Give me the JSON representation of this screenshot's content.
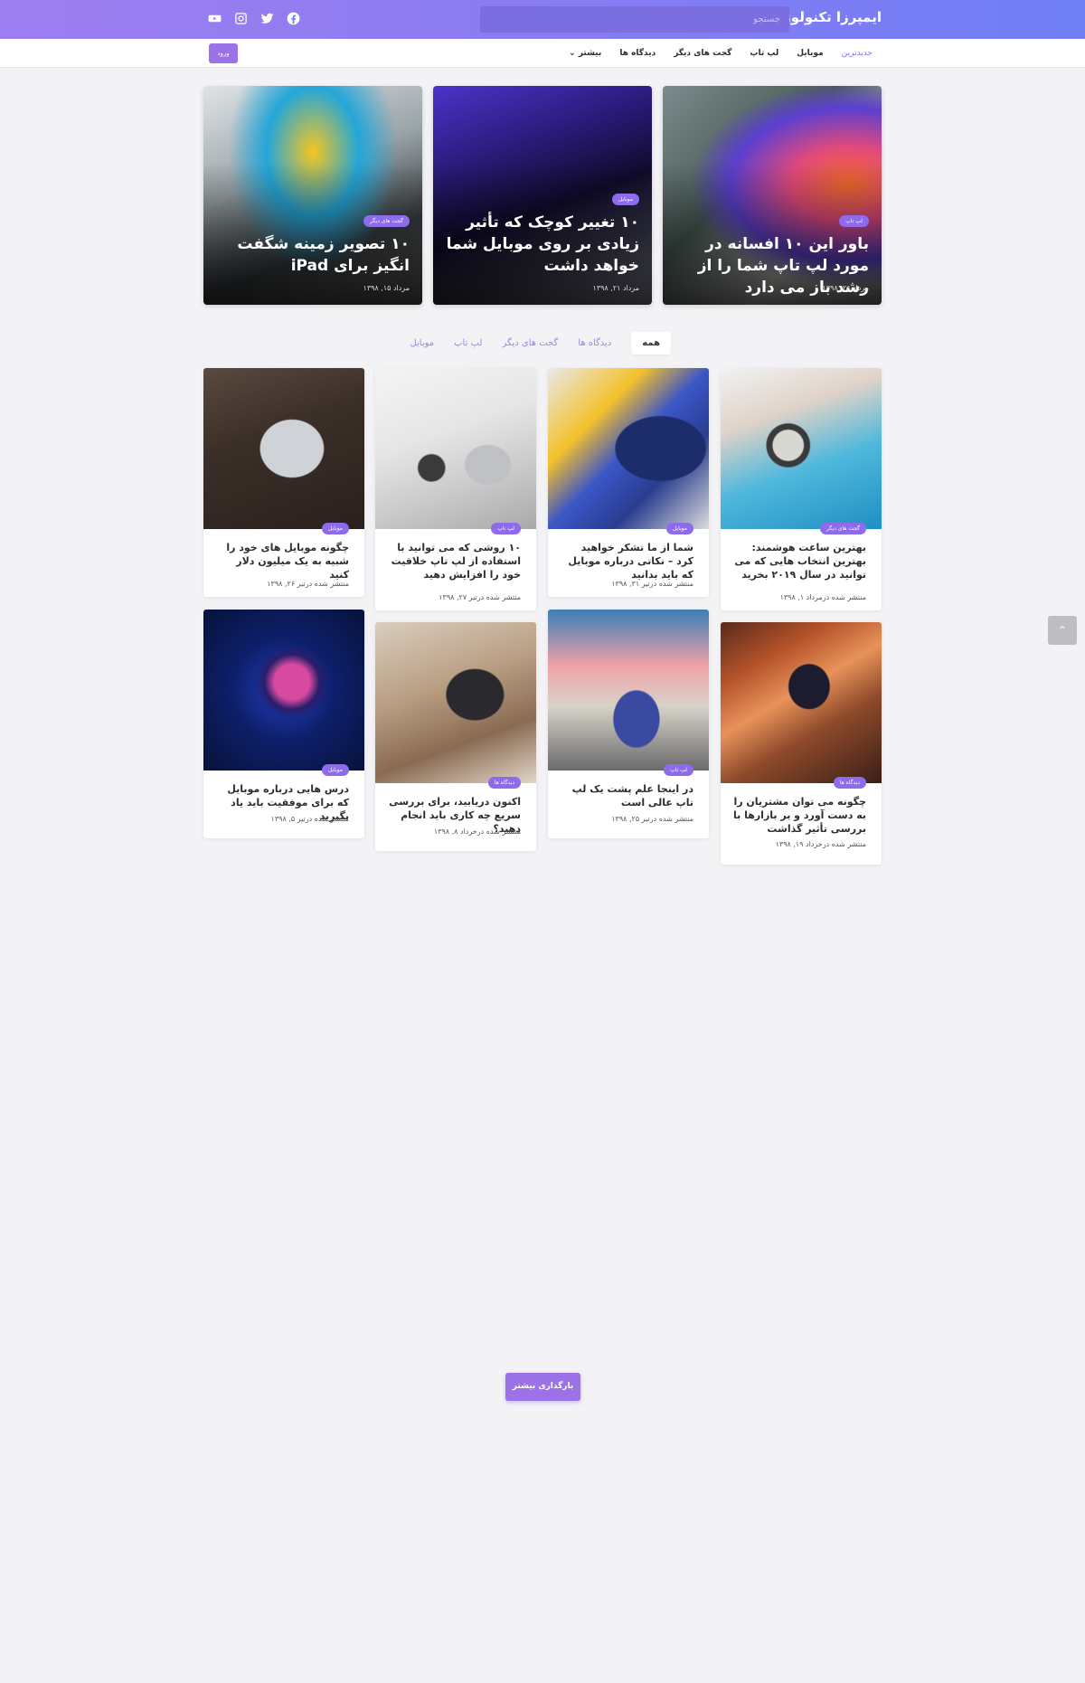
{
  "header": {
    "logo": "ایمپرزا تکنولوژی",
    "search_placeholder": "جستجو",
    "social": [
      "facebook-icon",
      "twitter-icon",
      "instagram-icon",
      "youtube-icon"
    ]
  },
  "nav": {
    "items": [
      "جدیدترین",
      "موبایل",
      "لپ تاپ",
      "گجت های دیگر",
      "دیدگاه ها",
      "بیشتر"
    ],
    "login": "ورود"
  },
  "featured": [
    {
      "badge": "لپ تاپ",
      "title": "باور این ۱۰ افسانه در مورد لپ تاپ شما را از رشد باز می دارد",
      "date": "مرداد ۲۶, ۱۳۹۸"
    },
    {
      "badge": "موبایل",
      "title": "۱۰ تغییر کوچک که تأثیر زیادی بر روی موبایل شما خواهد داشت",
      "date": "مرداد ۲۱, ۱۳۹۸"
    },
    {
      "badge": "گجت های دیگر",
      "title": "۱۰ تصویر زمینه شگفت انگیز برای iPad",
      "date": "مرداد ۱۵, ۱۳۹۸"
    }
  ],
  "filters": [
    "همه",
    "دیدگاه ها",
    "گجت های دیگر",
    "لپ تاپ",
    "موبایل"
  ],
  "cards": [
    {
      "badge": "گجت های دیگر",
      "title": "بهترین ساعت هوشمند: بهترین انتخاب هایی که می توانید در سال ۲۰۱۹ بخرید",
      "date": "منتشر شده درمرداد ۱, ۱۳۹۸"
    },
    {
      "badge": "موبایل",
      "title": "شما از ما تشکر خواهید کرد – نکاتی درباره موبایل که باید بدانید",
      "date": "منتشر شده درتیر ۳۱, ۱۳۹۸"
    },
    {
      "badge": "لپ تاپ",
      "title": "۱۰ روشی که می توانید با استفاده از لپ تاپ خلاقیت خود را افزایش دهید",
      "date": "منتشر شده درتیر ۲۷, ۱۳۹۸"
    },
    {
      "badge": "موبایل",
      "title": "چگونه موبایل های خود را شبیه به یک میلیون دلار کنید",
      "date": "منتشر شده درتیر ۲۶, ۱۳۹۸"
    },
    {
      "badge": "دیدگاه ها",
      "title": "چگونه می توان مشتریان را به دست آورد و بر بازارها با بررسی تأثیر گذاشت",
      "date": "منتشر شده درخرداد ۱۹, ۱۳۹۸"
    },
    {
      "badge": "لپ تاپ",
      "title": "در اینجا علم پشت یک لپ تاپ عالی است",
      "date": "منتشر شده درتیر ۲۵, ۱۳۹۸"
    },
    {
      "badge": "دیدگاه ها",
      "title": "اکنون دریابید، برای بررسی سریع چه کاری باید انجام دهید؟",
      "date": "منتشر شده درخرداد ۸, ۱۳۹۸"
    },
    {
      "badge": "موبایل",
      "title": "درس هایی درباره موبایل که برای موفقیت باید یاد بگیرید",
      "date": "منتشر شده درتیر ۵, ۱۳۹۸"
    }
  ],
  "load_more": "بارگذاری بیشتر",
  "colors": {
    "accent": "#8d6bea",
    "header_from": "#9d7ef0",
    "header_to": "#6f7ef6"
  }
}
